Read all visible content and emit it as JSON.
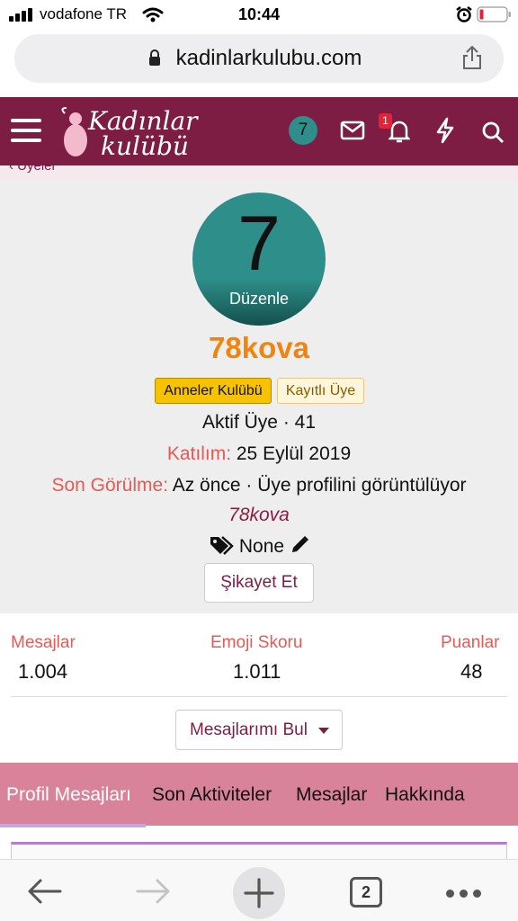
{
  "status_bar": {
    "carrier": "vodafone TR",
    "time": "10:44"
  },
  "browser": {
    "url": "kadinlarkulubu.com",
    "tab_count": "2"
  },
  "site": {
    "logo_line1": "Kadınlar",
    "logo_line2": "kulübü",
    "header_avatar": "7",
    "notification_count": "1",
    "breadcrumb": "Üyeler"
  },
  "profile": {
    "avatar_letter": "7",
    "avatar_edit": "Düzenle",
    "username": "78kova",
    "tags": [
      "Anneler Kulübü",
      "Kayıtlı Üye"
    ],
    "rank_line": "Aktif Üye · 41",
    "joined_label": "Katılım:",
    "joined_value": "25 Eylül 2019",
    "last_seen_label": "Son Görülme:",
    "last_seen_value": "Az önce · Üye profilini görüntülüyor",
    "viewing_user": "78kova",
    "tags_value": "None",
    "report_button": "Şikayet Et"
  },
  "stats": [
    {
      "label": "Mesajlar",
      "value": "1.004"
    },
    {
      "label": "Emoji Skoru",
      "value": "1.011"
    },
    {
      "label": "Puanlar",
      "value": "48"
    }
  ],
  "find_messages_button": "Mesajlarımı Bul",
  "tabs": [
    {
      "label": "Profil Mesajları",
      "active": true
    },
    {
      "label": "Son Aktiviteler",
      "active": false
    },
    {
      "label": "Mesajlar",
      "active": false
    },
    {
      "label": "Hakkında",
      "active": false
    }
  ],
  "colors": {
    "header": "#7e1d44",
    "accent_orange": "#f0840f",
    "label_red": "#e65a55",
    "tab_bar": "#d9839b",
    "avatar_teal": "#2e8f8a"
  }
}
